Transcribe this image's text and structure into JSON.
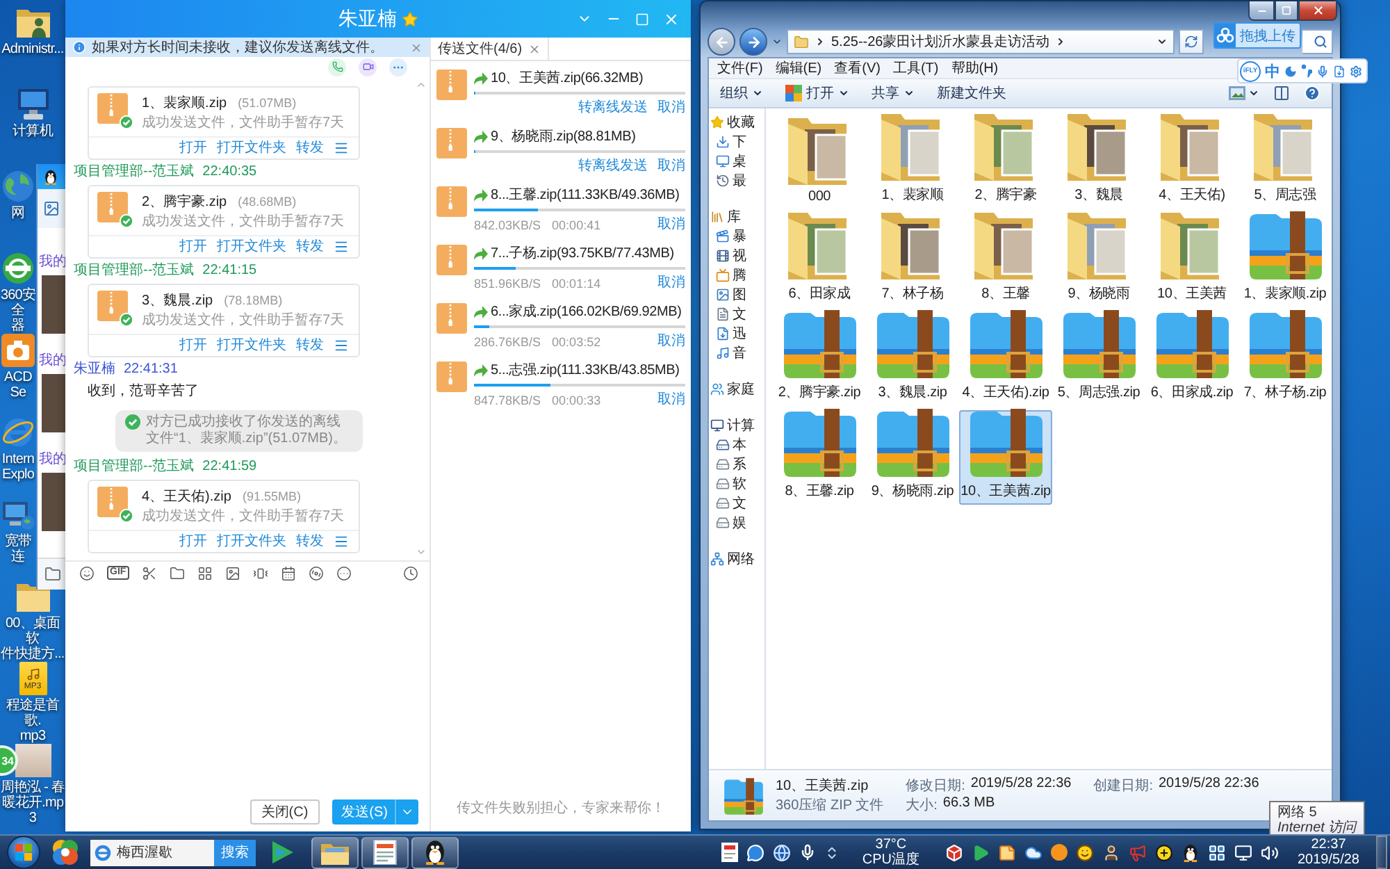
{
  "desktop": {
    "icons": [
      {
        "kind": "user-folder",
        "lines": [
          "Administr..."
        ]
      },
      {
        "kind": "computer",
        "lines": [
          "计算机"
        ]
      },
      {
        "kind": "network",
        "lines": [
          "网"
        ]
      },
      {
        "kind": "browser",
        "lines": [
          "360安全",
          "器"
        ]
      },
      {
        "kind": "camera",
        "lines": [
          "ACDSe"
        ]
      },
      {
        "kind": "ie",
        "lines": [
          "Intern",
          "Explo"
        ]
      },
      {
        "kind": "broadband",
        "lines": [
          "宽带连"
        ]
      },
      {
        "kind": "folder",
        "lines": [
          "00、桌面软",
          "件快捷方..."
        ]
      },
      {
        "kind": "mp3",
        "badge": "MP3",
        "lines": [
          "程途是首歌.",
          "mp3"
        ]
      },
      {
        "kind": "photo",
        "lines": [
          "周艳泓 - 春",
          "暖花开.mp3"
        ]
      }
    ],
    "float_ball": "34"
  },
  "back_window": {
    "labels": [
      "我的",
      "我的",
      "我的"
    ]
  },
  "chat_window": {
    "title": "朱亚楠",
    "notice": "如果对方长时间未接收，建议你发送离线文件。",
    "messages": [
      {
        "kind": "file",
        "name": "1、裴家顺.zip",
        "size": "(51.07MB)",
        "status": "成功发送文件，文件助手暂存7天",
        "actions": [
          "打开",
          "打开文件夹",
          "转发"
        ]
      },
      {
        "kind": "sender",
        "name": "项目管理部--范玉斌",
        "time": "22:40:35",
        "self": true
      },
      {
        "kind": "file",
        "name": "2、腾宇豪.zip",
        "size": "(48.68MB)",
        "status": "成功发送文件，文件助手暂存7天",
        "actions": [
          "打开",
          "打开文件夹",
          "转发"
        ]
      },
      {
        "kind": "sender",
        "name": "项目管理部--范玉斌",
        "time": "22:41:15",
        "self": true
      },
      {
        "kind": "file",
        "name": "3、魏晨.zip",
        "size": "(78.18MB)",
        "status": "成功发送文件，文件助手暂存7天",
        "actions": [
          "打开",
          "打开文件夹",
          "转发"
        ]
      },
      {
        "kind": "sender",
        "name": "朱亚楠",
        "time": "22:41:31",
        "self": false
      },
      {
        "kind": "text",
        "text": "收到，范哥辛苦了"
      },
      {
        "kind": "notice",
        "text": "对方已成功接收了你发送的离线文件“1、裴家顺.zip”(51.07MB)。"
      },
      {
        "kind": "sender",
        "name": "项目管理部--范玉斌",
        "time": "22:41:59",
        "self": true
      },
      {
        "kind": "file",
        "name": "4、王天佑).zip",
        "size": "(91.55MB)",
        "status": "成功发送文件，文件助手暂存7天",
        "actions": [
          "打开",
          "打开文件夹",
          "转发"
        ]
      }
    ],
    "gif_label": "GIF",
    "buttons": [
      {
        "kind": "close",
        "label": "关闭(C)"
      },
      {
        "kind": "send",
        "label": "发送(S)"
      }
    ],
    "transfers": {
      "tab": "传送文件(4/6)",
      "items": [
        {
          "name": "10、王美茜.zip(66.32MB)",
          "level": 0,
          "actions": [
            "转离线发送",
            "取消"
          ]
        },
        {
          "name": "9、杨晓雨.zip(88.81MB)",
          "level": 0,
          "actions": [
            "转离线发送",
            "取消"
          ]
        },
        {
          "name": "8...王馨.zip(111.33KB/49.36MB)",
          "level": 0.3,
          "speed": "842.03KB/S",
          "remaining": "00:00:41",
          "actions": [
            "取消"
          ]
        },
        {
          "name": "7...子杨.zip(93.75KB/77.43MB)",
          "level": 0.2,
          "speed": "851.96KB/S",
          "remaining": "00:01:14",
          "actions": [
            "取消"
          ]
        },
        {
          "name": "6...家成.zip(166.02KB/69.92MB)",
          "level": 0.07,
          "speed": "286.76KB/S",
          "remaining": "00:03:52",
          "actions": [
            "取消"
          ]
        },
        {
          "name": "5...志强.zip(111.33KB/43.85MB)",
          "level": 0.36,
          "speed": "847.78KB/S",
          "remaining": "00:00:33",
          "actions": [
            "取消"
          ]
        }
      ],
      "footer": "传文件失败别担心，专家来帮你！"
    }
  },
  "explorer": {
    "nav_buttons": [
      {
        "kind": "back",
        "disabled": true
      },
      {
        "kind": "forward",
        "disabled": false
      }
    ],
    "path": "5.25--26蒙田计划沂水蒙县走访活动",
    "menu": [
      "文件(F)",
      "编辑(E)",
      "查看(V)",
      "工具(T)",
      "帮助(H)"
    ],
    "commands": [
      {
        "kind": "organize",
        "label": "组织",
        "dropdown": true
      },
      {
        "kind": "open",
        "label": "打开",
        "dropdown": true
      },
      {
        "kind": "share",
        "label": "共享",
        "dropdown": true
      },
      {
        "kind": "new-folder",
        "label": "新建文件夹",
        "dropdown": false
      }
    ],
    "nav": [
      {
        "label": "收藏",
        "kind": "favorites",
        "children": [
          {
            "label": "下",
            "kind": "downloads"
          },
          {
            "label": "桌",
            "kind": "desktop"
          },
          {
            "label": "最",
            "kind": "recent"
          }
        ]
      },
      {
        "label": "库",
        "kind": "libraries",
        "children": [
          {
            "label": "暴",
            "kind": "video-app"
          },
          {
            "label": "视",
            "kind": "videos"
          },
          {
            "label": "腾",
            "kind": "tv"
          },
          {
            "label": "图",
            "kind": "pictures"
          },
          {
            "label": "文",
            "kind": "documents"
          },
          {
            "label": "迅",
            "kind": "download-app"
          },
          {
            "label": "音",
            "kind": "music"
          }
        ]
      },
      {
        "label": "家庭",
        "kind": "homegroup"
      },
      {
        "label": "计算",
        "kind": "computer",
        "children": [
          {
            "label": "本",
            "kind": "local-disk"
          },
          {
            "label": "系",
            "kind": "drive"
          },
          {
            "label": "软",
            "kind": "drive"
          },
          {
            "label": "文",
            "kind": "drive"
          },
          {
            "label": "娱",
            "kind": "drive"
          }
        ]
      },
      {
        "label": "网络",
        "kind": "network"
      }
    ],
    "files": [
      {
        "name": "000",
        "kind": "folder",
        "selected": false
      },
      {
        "name": "1、裴家顺",
        "kind": "folder",
        "selected": false
      },
      {
        "name": "2、腾宇豪",
        "kind": "folder",
        "selected": false
      },
      {
        "name": "3、魏晨",
        "kind": "folder",
        "selected": false
      },
      {
        "name": "4、王天佑)",
        "kind": "folder",
        "selected": false
      },
      {
        "name": "5、周志强",
        "kind": "folder",
        "selected": false
      },
      {
        "name": "6、田家成",
        "kind": "folder",
        "selected": false
      },
      {
        "name": "7、林子杨",
        "kind": "folder",
        "selected": false
      },
      {
        "name": "8、王馨",
        "kind": "folder",
        "selected": false
      },
      {
        "name": "9、杨晓雨",
        "kind": "folder",
        "selected": false
      },
      {
        "name": "10、王美茜",
        "kind": "folder",
        "selected": false
      },
      {
        "name": "1、裴家顺.zip",
        "kind": "zip",
        "selected": false
      },
      {
        "name": "2、腾宇豪.zip",
        "kind": "zip",
        "selected": false
      },
      {
        "name": "3、魏晨.zip",
        "kind": "zip",
        "selected": false
      },
      {
        "name": "4、王天佑).zip",
        "kind": "zip",
        "selected": false
      },
      {
        "name": "5、周志强.zip",
        "kind": "zip",
        "selected": false
      },
      {
        "name": "6、田家成.zip",
        "kind": "zip",
        "selected": false
      },
      {
        "name": "7、林子杨.zip",
        "kind": "zip",
        "selected": false
      },
      {
        "name": "8、王馨.zip",
        "kind": "zip",
        "selected": false
      },
      {
        "name": "9、杨晓雨.zip",
        "kind": "zip",
        "selected": false
      },
      {
        "name": "10、王美茜.zip",
        "kind": "zip",
        "selected": true
      }
    ],
    "details": {
      "name": "10、王美茜.zip",
      "type": "360压缩 ZIP 文件",
      "fields": [
        {
          "label": "修改日期:",
          "value": "2019/5/28 22:36"
        },
        {
          "label": "大小:",
          "value": "66.3 MB"
        },
        {
          "label": "创建日期:",
          "value": "2019/5/28 22:36"
        }
      ]
    }
  },
  "upload_badge": "拖拽上传",
  "ime_bar": {
    "logo": "iFLY",
    "mode": "中"
  },
  "tooltip": {
    "title": "网络 5",
    "subtitle": "Internet 访问"
  },
  "taskbar": {
    "search_value": "梅西渥歇",
    "search_button": "搜索",
    "temperature": "37°C",
    "temperature_label": "CPU温度",
    "time": "22:37",
    "date": "2019/5/28"
  }
}
